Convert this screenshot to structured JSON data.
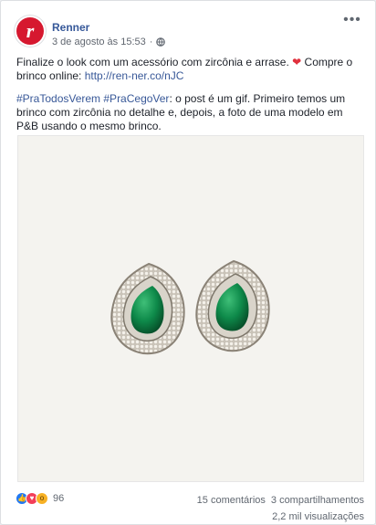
{
  "post": {
    "page_name": "Renner",
    "avatar_letter": "r",
    "date": "3 de agosto às 15:53",
    "dot": "·",
    "more_label": "•••",
    "text_line1_pre": "Finalize o look com um acessório com zircônia e arrase. ",
    "text_line1_post": " Compre o brinco online: ",
    "link": "http://ren-ner.co/nJC",
    "hashtags": "#PraTodosVerem #PraCegoVer",
    "description": ": o post é um gif. Primeiro temos um brinco com zircônia no detalhe e, depois, a foto de uma modelo em P&B usando o mesmo brinco."
  },
  "footer": {
    "reaction_count": "96",
    "comments": "15 comentários",
    "shares": "3 compartilhamentos",
    "views": "2,2 mil visualizações"
  },
  "icons": {
    "heart": "red-heart-icon",
    "globe": "globe-icon",
    "like": "like-reaction-icon",
    "love": "love-reaction-icon",
    "wow": "wow-reaction-icon"
  },
  "colors": {
    "link": "#385898",
    "page_name": "#365899",
    "brand_red": "#d6182f",
    "emerald": "#0e8a4a"
  }
}
